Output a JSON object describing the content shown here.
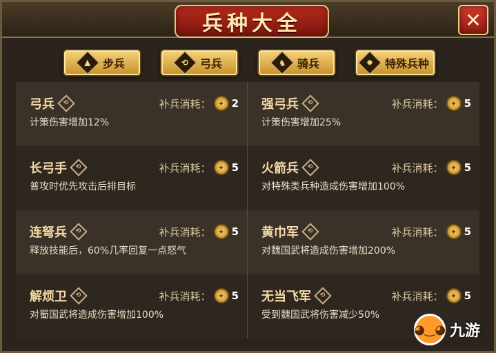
{
  "title": "兵种大全",
  "close_glyph": "✕",
  "tabs": [
    {
      "label": "步兵",
      "icon": "boot-icon",
      "glyph": "▲"
    },
    {
      "label": "弓兵",
      "icon": "bow-icon",
      "glyph": "⟲"
    },
    {
      "label": "骑兵",
      "icon": "horse-icon",
      "glyph": "♞"
    },
    {
      "label": "特殊兵种",
      "icon": "star-icon",
      "glyph": "✹"
    }
  ],
  "cost_label": "补兵消耗：",
  "units": [
    {
      "name": "弓兵",
      "cost": "2",
      "desc": "计策伤害增加12%"
    },
    {
      "name": "强弓兵",
      "cost": "5",
      "desc": "计策伤害增加25%"
    },
    {
      "name": "长弓手",
      "cost": "5",
      "desc": "普攻时优先攻击后排目标"
    },
    {
      "name": "火箭兵",
      "cost": "5",
      "desc": "对特殊类兵种造成伤害增加100%"
    },
    {
      "name": "连弩兵",
      "cost": "5",
      "desc": "释放技能后，60%几率回复一点怒气"
    },
    {
      "name": "黄巾军",
      "cost": "5",
      "desc": "对魏国武将造成伤害增加200%"
    },
    {
      "name": "解烦卫",
      "cost": "5",
      "desc": "对蜀国武将造成伤害增加100%"
    },
    {
      "name": "无当飞军",
      "cost": "5",
      "desc": "受到魏国武将伤害减少50%"
    }
  ],
  "watermark": {
    "text": "九游",
    "icon": "mascot-icon"
  },
  "colors": {
    "title_banner": "#b52a1c",
    "tab_gold": "#f7d37c",
    "panel_bg": "#2a241c",
    "text_name": "#f6d9a6"
  }
}
